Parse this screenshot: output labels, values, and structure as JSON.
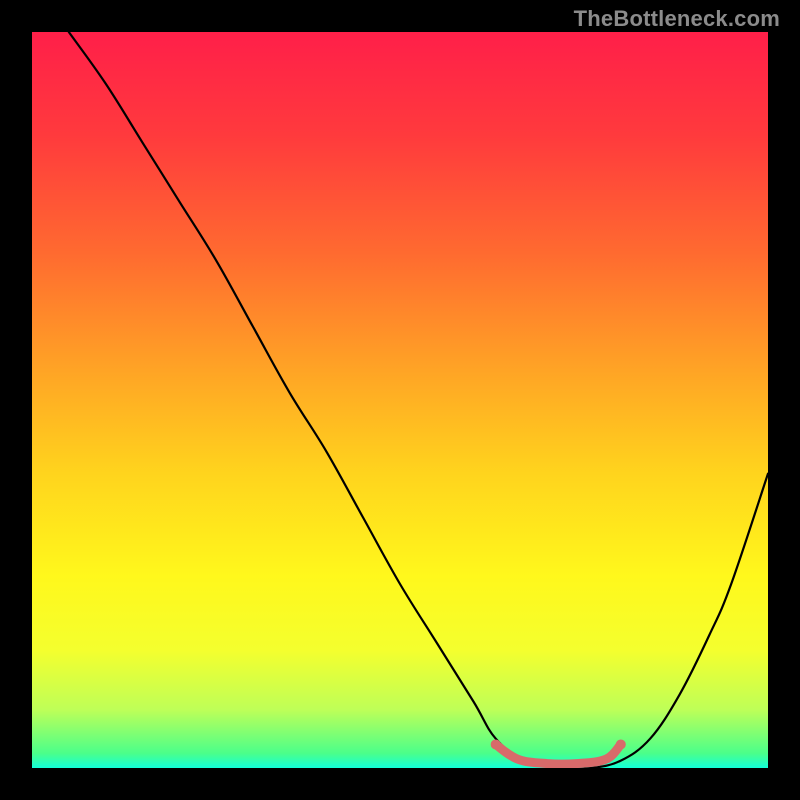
{
  "watermark": "TheBottleneck.com",
  "chart_data": {
    "type": "line",
    "title": "",
    "xlabel": "",
    "ylabel": "",
    "xlim": [
      0,
      100
    ],
    "ylim": [
      0,
      100
    ],
    "grid": false,
    "legend": false,
    "gradient_stops": [
      {
        "offset": 0.0,
        "color": "#ff1f49"
      },
      {
        "offset": 0.14,
        "color": "#ff3a3d"
      },
      {
        "offset": 0.3,
        "color": "#ff6a30"
      },
      {
        "offset": 0.46,
        "color": "#ffa425"
      },
      {
        "offset": 0.6,
        "color": "#ffd41d"
      },
      {
        "offset": 0.74,
        "color": "#fff81c"
      },
      {
        "offset": 0.84,
        "color": "#f4ff2e"
      },
      {
        "offset": 0.92,
        "color": "#bfff57"
      },
      {
        "offset": 0.98,
        "color": "#4bff8a"
      },
      {
        "offset": 1.0,
        "color": "#13ffd8"
      }
    ],
    "series": [
      {
        "name": "bottleneck-curve",
        "color": "#000000",
        "x": [
          5,
          10,
          15,
          20,
          25,
          30,
          35,
          40,
          45,
          50,
          55,
          60,
          63,
          67,
          72,
          76,
          80,
          84,
          88,
          92,
          95,
          100
        ],
        "y": [
          100,
          93,
          85,
          77,
          69,
          60,
          51,
          43,
          34,
          25,
          17,
          9,
          4,
          1,
          0,
          0,
          1,
          4,
          10,
          18,
          25,
          40
        ]
      }
    ],
    "highlight_segment": {
      "name": "optimal-zone",
      "color": "#d86a6a",
      "x": [
        63,
        66,
        70,
        74,
        78,
        80
      ],
      "y": [
        3.2,
        1.2,
        0.6,
        0.6,
        1.2,
        3.2
      ],
      "endpoint_radius_px": 5,
      "stroke_width_px": 9
    }
  }
}
